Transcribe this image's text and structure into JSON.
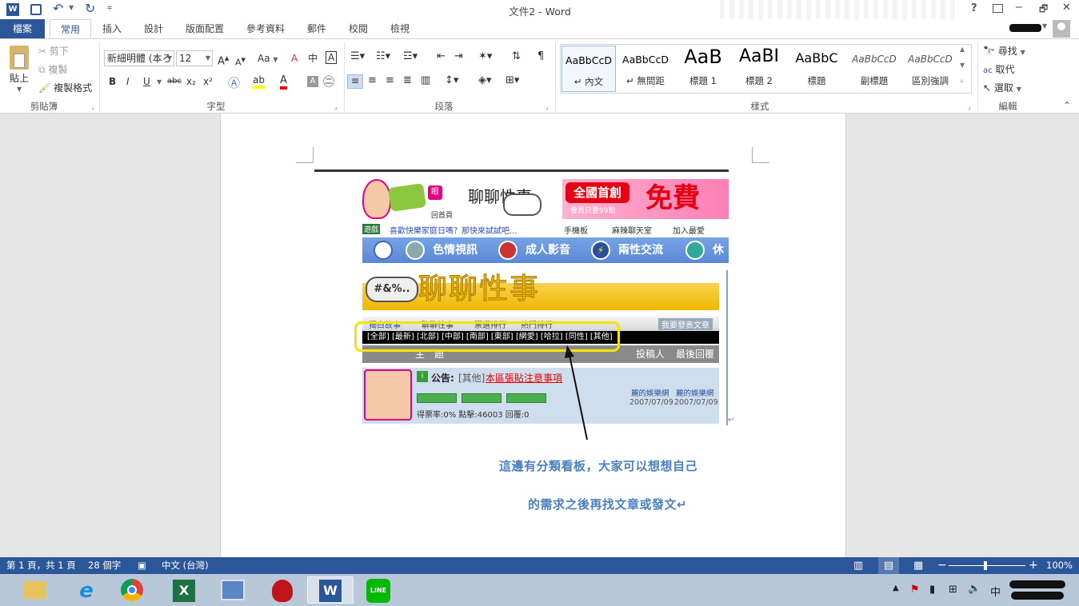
{
  "app": {
    "title": "文件2 - Word",
    "help": "?",
    "minimize": "─",
    "restore": "🗗",
    "close": "✕"
  },
  "tabs": [
    "檔案",
    "常用",
    "插入",
    "設計",
    "版面配置",
    "參考資料",
    "郵件",
    "校閱",
    "檢視"
  ],
  "ribbon": {
    "clipboard": {
      "paste": "貼上",
      "cut": "剪下",
      "copy": "複製",
      "format_painter": "複製格式",
      "label": "剪貼簿"
    },
    "font": {
      "name": "新細明體 (本ろ",
      "size": "12",
      "label": "字型",
      "bold": "B",
      "italic": "I",
      "underline": "U",
      "strike": "abc",
      "sub": "x₂",
      "sup": "x²",
      "grow": "A",
      "shrink": "A",
      "case": "Aa",
      "clear": "A",
      "phonetic": "中",
      "border": "A"
    },
    "paragraph": {
      "label": "段落"
    },
    "styles": {
      "label": "樣式",
      "items": [
        {
          "sample": "AaBbCcD",
          "name": "↵ 內文"
        },
        {
          "sample": "AaBbCcD",
          "name": "↵ 無間距"
        },
        {
          "sample": "AaB",
          "name": "標題 1"
        },
        {
          "sample": "AaBI",
          "name": "標題 2"
        },
        {
          "sample": "AaBbC",
          "name": "標題"
        },
        {
          "sample": "AaBbCcD",
          "name": "副標題"
        },
        {
          "sample": "AaBbCcD",
          "name": "區別強調"
        }
      ]
    },
    "editing": {
      "find": "尋找",
      "replace": "取代",
      "select": "選取",
      "label": "編輯"
    }
  },
  "web": {
    "logo_text": "聊聊性事",
    "home": "回首頁",
    "banner1": "全國首創",
    "banner1_sub": "會員只要99點",
    "banner2": "免費",
    "ticker_badge": "遊戲",
    "ticker": "喜歡快樂家庭日嗎？那快來試試吧...",
    "link1": "手機板",
    "link2": "麻辣聊天室",
    "link3": "加入最愛",
    "nav": [
      "色情視訊",
      "成人影音",
      "兩性交流",
      "休"
    ],
    "board_title": "聊聊性事",
    "board_badge": "#&%..",
    "subtabs": [
      "獨白故事",
      "聊聊性事",
      "票選排行",
      "熱門排行"
    ],
    "post_btn": "我要發表文章",
    "categories": "[全部] [最新] [北部] [中部] [南部] [東部] [網愛] [哈拉] [同性] [其他]",
    "col_subject": "主　題",
    "col_poster": "投稿人",
    "col_last": "最後回覆",
    "notice_prefix": "公告:",
    "notice_tag": "[其他]",
    "notice_title": "本區張貼注意事項",
    "poster": "麗的娛樂網",
    "last": "麗的娛樂網",
    "date1": "2007/07/09",
    "date2": "2007/07/09",
    "stats": "得票率:0%  點擊:46003  回覆:0"
  },
  "annotation": {
    "line1": "這邊有分類看板，大家可以想想自己",
    "line2": "的需求之後再找文章或發文↵"
  },
  "status": {
    "page": "第 1 頁，共 1 頁",
    "words": "28 個字",
    "lang": "中文 (台灣)",
    "zoom": "100%"
  },
  "taskbar": {
    "ime": "中"
  },
  "colors": {
    "word_blue": "#2b579a",
    "annotation_blue": "#4a7fc1",
    "highlight_yellow": "#f5e400"
  }
}
